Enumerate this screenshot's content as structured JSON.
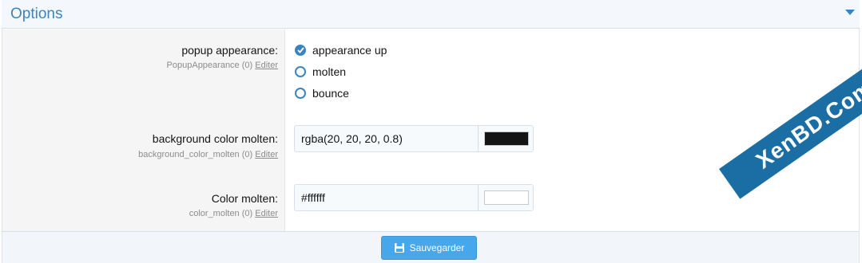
{
  "header": {
    "title": "Options"
  },
  "options": [
    {
      "label": "popup appearance:",
      "sub": "PopupAppearance (0)",
      "edit": "Editer",
      "radios": [
        {
          "label": "appearance up",
          "checked": true
        },
        {
          "label": "molten",
          "checked": false
        },
        {
          "label": "bounce",
          "checked": false
        }
      ]
    },
    {
      "label": "background color molten:",
      "sub": "background_color_molten (0)",
      "edit": "Editer",
      "value": "rgba(20, 20, 20, 0.8)",
      "swatch_color": "#141414"
    },
    {
      "label": "Color molten:",
      "sub": "color_molten (0)",
      "edit": "Editer",
      "value": "#ffffff",
      "swatch_color": "#ffffff"
    }
  ],
  "footer": {
    "save_label": "Sauvegarder"
  },
  "watermark": "XenBD.Com",
  "colors": {
    "accent": "#3b84c0",
    "button": "#47a7eb"
  }
}
